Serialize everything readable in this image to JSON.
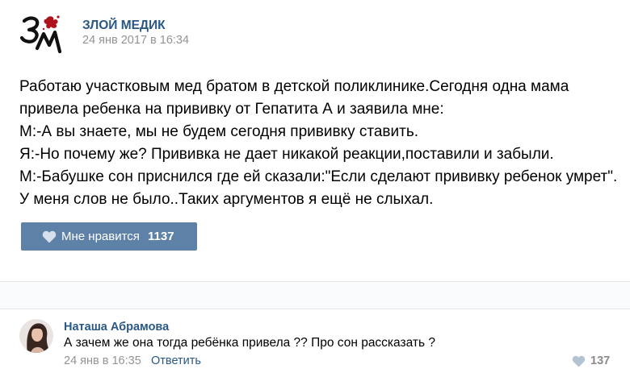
{
  "post": {
    "group_name": "ЗЛОЙ МЕДИК",
    "date": "24 янв 2017 в 16:34",
    "logo_text": "ЗМ",
    "text_lines": [
      "Работаю участковым мед братом в детской поликлинике.Сегодня одна мама",
      "привела ребенка на прививку от Гепатита А и заявила мне:",
      "М:-А вы знаете, мы не будем сегодня прививку ставить.",
      "Я:-Но почему же? Прививка не дает никакой реакции,поставили и забыли.",
      "М:-Бабушке сон приснился где ей сказали:\"Если сделают прививку ребенок умрет\".",
      "У меня слов не было..Таких аргументов я ещё не слыхал."
    ],
    "like_label": "Мне нравится",
    "like_count": "1137"
  },
  "comment": {
    "author": "Наташа Абрамова",
    "text": "А зачем же она тогда ребёнка привела ?? Про сон рассказать ?",
    "date": "24 янв в 16:35",
    "reply_label": "Ответить",
    "like_count": "137"
  },
  "icons": {
    "like": "heart-icon",
    "comment_like": "heart-icon"
  },
  "colors": {
    "link": "#2a5885",
    "button": "#5e81a8",
    "muted": "#939393",
    "logo_splash": "#b0121b"
  }
}
